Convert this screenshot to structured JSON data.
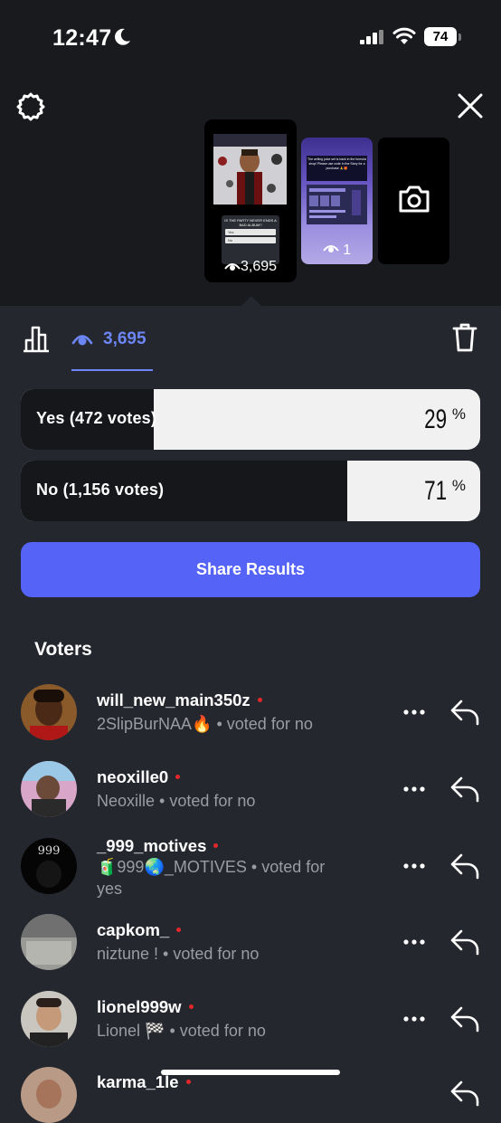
{
  "status_bar": {
    "time": "12:47",
    "battery": "74"
  },
  "stories": [
    {
      "views": "3,695",
      "poll_question": "IS THE PARTY NEVER ENDS A BAD ALBUM?",
      "poll_options": [
        "Yes",
        "No"
      ]
    },
    {
      "views": "1",
      "text": "The writing juice set is back in the formula shop! Please use code in the Story for a purchase 🙏🎁"
    }
  ],
  "tabs": {
    "views_count": "3,695"
  },
  "poll": {
    "options": [
      {
        "label": "Yes (472 votes)",
        "percent": "29",
        "fraction": 0.29
      },
      {
        "label": "No (1,156 votes)",
        "percent": "71",
        "fraction": 0.71
      }
    ],
    "percent_sign": "%"
  },
  "share_button": "Share Results",
  "voters_heading": "Voters",
  "voters": [
    {
      "username": "will_new_main350z",
      "display": "2SlipBurNAA🔥",
      "vote": "voted for no"
    },
    {
      "username": "neoxille0",
      "display": "Neoxille",
      "vote": "voted for no"
    },
    {
      "username": "_999_motives",
      "display": "🧃999🌏_MOTIVES",
      "vote": "voted for yes"
    },
    {
      "username": "capkom_",
      "display": "niztune !",
      "vote": "voted for no"
    },
    {
      "username": "lionel999w",
      "display": "Lionel 🏁",
      "vote": "voted for no"
    },
    {
      "username": "karma_1le",
      "display": "",
      "vote": ""
    }
  ],
  "colors": {
    "accent": "#5563f7",
    "link": "#6d86f5",
    "online_dot": "#e4272a",
    "background": "#25272f"
  }
}
